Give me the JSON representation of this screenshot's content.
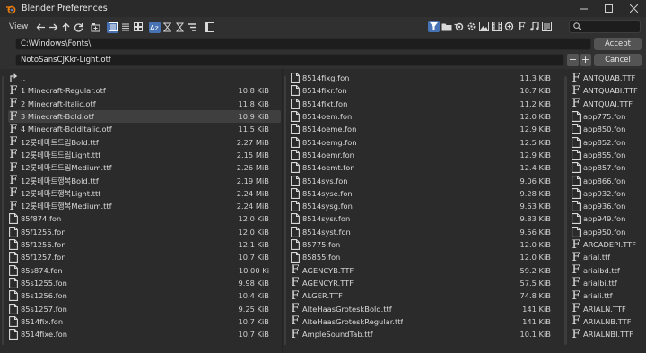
{
  "window": {
    "title": "Blender Preferences"
  },
  "toolbar": {
    "view_label": "View",
    "search_placeholder": ""
  },
  "path": {
    "directory": "C:\\Windows\\Fonts\\",
    "filename": "NotoSansCJKkr-Light.otf"
  },
  "buttons": {
    "accept": "Accept",
    "cancel": "Cancel",
    "minus": "−",
    "plus": "+"
  },
  "columns": [
    {
      "items": [
        {
          "icon": "parent-folder-icon",
          "name": "..",
          "size": ""
        },
        {
          "icon": "font-file-icon",
          "name": "1 Minecraft-Regular.otf",
          "size": "10.8 KiB"
        },
        {
          "icon": "font-file-icon",
          "name": "2 Minecraft-Italic.otf",
          "size": "11.8 KiB"
        },
        {
          "icon": "font-file-icon",
          "name": "3 Minecraft-Bold.otf",
          "size": "10.9 KiB",
          "selected": true
        },
        {
          "icon": "font-file-icon",
          "name": "4 Minecraft-BoldItalic.otf",
          "size": "11.5 KiB"
        },
        {
          "icon": "font-file-icon",
          "name": "12롯데마트드림Bold.ttf",
          "size": "2.27 MiB"
        },
        {
          "icon": "font-file-icon",
          "name": "12롯데마트드림Light.ttf",
          "size": "2.15 MiB"
        },
        {
          "icon": "font-file-icon",
          "name": "12롯데마트드림Medium.ttf",
          "size": "2.26 MiB"
        },
        {
          "icon": "font-file-icon",
          "name": "12롯데마트행복Bold.ttf",
          "size": "2.19 MiB"
        },
        {
          "icon": "font-file-icon",
          "name": "12롯데마트행복Light.ttf",
          "size": "2.24 MiB"
        },
        {
          "icon": "font-file-icon",
          "name": "12롯데마트행복Medium.ttf",
          "size": "2.24 MiB"
        },
        {
          "icon": "file-icon",
          "name": "85f874.fon",
          "size": "12.0 KiB"
        },
        {
          "icon": "file-icon",
          "name": "85f1255.fon",
          "size": "12.0 KiB"
        },
        {
          "icon": "file-icon",
          "name": "85f1256.fon",
          "size": "12.1 KiB"
        },
        {
          "icon": "file-icon",
          "name": "85f1257.fon",
          "size": "10.7 KiB"
        },
        {
          "icon": "file-icon",
          "name": "85s874.fon",
          "size": "10.00 Ki"
        },
        {
          "icon": "file-icon",
          "name": "85s1255.fon",
          "size": "9.98 KiB"
        },
        {
          "icon": "file-icon",
          "name": "85s1256.fon",
          "size": "10.4 KiB"
        },
        {
          "icon": "file-icon",
          "name": "85s1257.fon",
          "size": "9.25 KiB"
        },
        {
          "icon": "file-icon",
          "name": "8514fix.fon",
          "size": "10.7 KiB"
        },
        {
          "icon": "file-icon",
          "name": "8514fixe.fon",
          "size": "10.7 KiB"
        }
      ]
    },
    {
      "items": [
        {
          "icon": "file-icon",
          "name": "8514fixg.fon",
          "size": "11.3 KiB"
        },
        {
          "icon": "file-icon",
          "name": "8514fixr.fon",
          "size": "10.7 KiB"
        },
        {
          "icon": "file-icon",
          "name": "8514fixt.fon",
          "size": "11.2 KiB"
        },
        {
          "icon": "file-icon",
          "name": "8514oem.fon",
          "size": "12.0 KiB"
        },
        {
          "icon": "file-icon",
          "name": "8514oeme.fon",
          "size": "12.9 KiB"
        },
        {
          "icon": "file-icon",
          "name": "8514oemg.fon",
          "size": "12.5 KiB"
        },
        {
          "icon": "file-icon",
          "name": "8514oemr.fon",
          "size": "12.9 KiB"
        },
        {
          "icon": "file-icon",
          "name": "8514oemt.fon",
          "size": "12.4 KiB"
        },
        {
          "icon": "file-icon",
          "name": "8514sys.fon",
          "size": "9.06 KiB"
        },
        {
          "icon": "file-icon",
          "name": "8514syse.fon",
          "size": "9.28 KiB"
        },
        {
          "icon": "file-icon",
          "name": "8514sysg.fon",
          "size": "9.63 KiB"
        },
        {
          "icon": "file-icon",
          "name": "8514sysr.fon",
          "size": "9.83 KiB"
        },
        {
          "icon": "file-icon",
          "name": "8514syst.fon",
          "size": "9.56 KiB"
        },
        {
          "icon": "file-icon",
          "name": "85775.fon",
          "size": "12.0 KiB"
        },
        {
          "icon": "file-icon",
          "name": "85855.fon",
          "size": "12.0 KiB"
        },
        {
          "icon": "font-file-icon",
          "name": "AGENCYB.TTF",
          "size": "59.2 KiB"
        },
        {
          "icon": "font-file-icon",
          "name": "AGENCYR.TTF",
          "size": "57.5 KiB"
        },
        {
          "icon": "font-file-icon",
          "name": "ALGER.TTF",
          "size": "74.8 KiB"
        },
        {
          "icon": "font-file-icon",
          "name": "AlteHaasGroteskBold.ttf",
          "size": "141 KiB"
        },
        {
          "icon": "font-file-icon",
          "name": "AlteHaasGroteskRegular.ttf",
          "size": "141 KiB"
        },
        {
          "icon": "font-file-icon",
          "name": "AmpleSoundTab.ttf",
          "size": "10.1 KiB"
        }
      ]
    },
    {
      "items": [
        {
          "icon": "font-file-icon",
          "name": "ANTQUAB.TTF",
          "size": ""
        },
        {
          "icon": "font-file-icon",
          "name": "ANTQUABI.TTF",
          "size": ""
        },
        {
          "icon": "font-file-icon",
          "name": "ANTQUAI.TTF",
          "size": ""
        },
        {
          "icon": "file-icon",
          "name": "app775.fon",
          "size": ""
        },
        {
          "icon": "file-icon",
          "name": "app850.fon",
          "size": ""
        },
        {
          "icon": "file-icon",
          "name": "app852.fon",
          "size": ""
        },
        {
          "icon": "file-icon",
          "name": "app855.fon",
          "size": ""
        },
        {
          "icon": "file-icon",
          "name": "app857.fon",
          "size": ""
        },
        {
          "icon": "file-icon",
          "name": "app866.fon",
          "size": ""
        },
        {
          "icon": "file-icon",
          "name": "app932.fon",
          "size": ""
        },
        {
          "icon": "file-icon",
          "name": "app936.fon",
          "size": ""
        },
        {
          "icon": "file-icon",
          "name": "app949.fon",
          "size": ""
        },
        {
          "icon": "file-icon",
          "name": "app950.fon",
          "size": ""
        },
        {
          "icon": "font-file-icon",
          "name": "ARCADEPI.TTF",
          "size": ""
        },
        {
          "icon": "font-file-icon",
          "name": "arial.ttf",
          "size": ""
        },
        {
          "icon": "font-file-icon",
          "name": "arialbd.ttf",
          "size": ""
        },
        {
          "icon": "font-file-icon",
          "name": "arialbi.ttf",
          "size": ""
        },
        {
          "icon": "font-file-icon",
          "name": "ariali.ttf",
          "size": ""
        },
        {
          "icon": "font-file-icon",
          "name": "ARIALN.TTF",
          "size": ""
        },
        {
          "icon": "font-file-icon",
          "name": "ARIALNB.TTF",
          "size": ""
        },
        {
          "icon": "font-file-icon",
          "name": "ARIALNBI.TTF",
          "size": ""
        }
      ]
    }
  ],
  "colors": {
    "accent": "#4772b3",
    "background": "#2b2b2b",
    "header": "#303030",
    "selected_row": "#3f3f3f"
  }
}
